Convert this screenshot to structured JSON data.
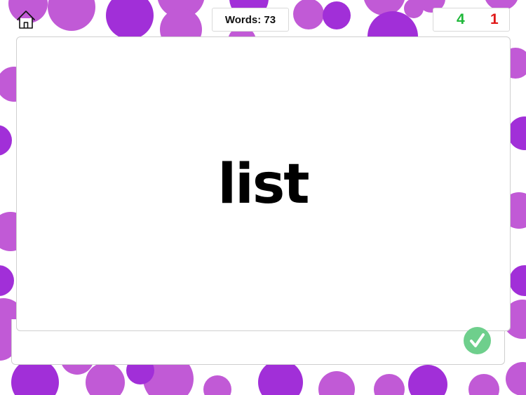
{
  "header": {
    "home_icon": "home-icon",
    "words_counter": "Words: 73"
  },
  "score": {
    "correct": "4",
    "wrong": "1",
    "correct_color": "#1fb83a",
    "wrong_color": "#e01818"
  },
  "card": {
    "word": "list"
  },
  "actions": {
    "check_icon": "check-icon",
    "check_color": "#6ecf8c"
  },
  "background": {
    "dot_color_light": "#c15ad6",
    "dot_color_dark": "#a12fd8"
  }
}
